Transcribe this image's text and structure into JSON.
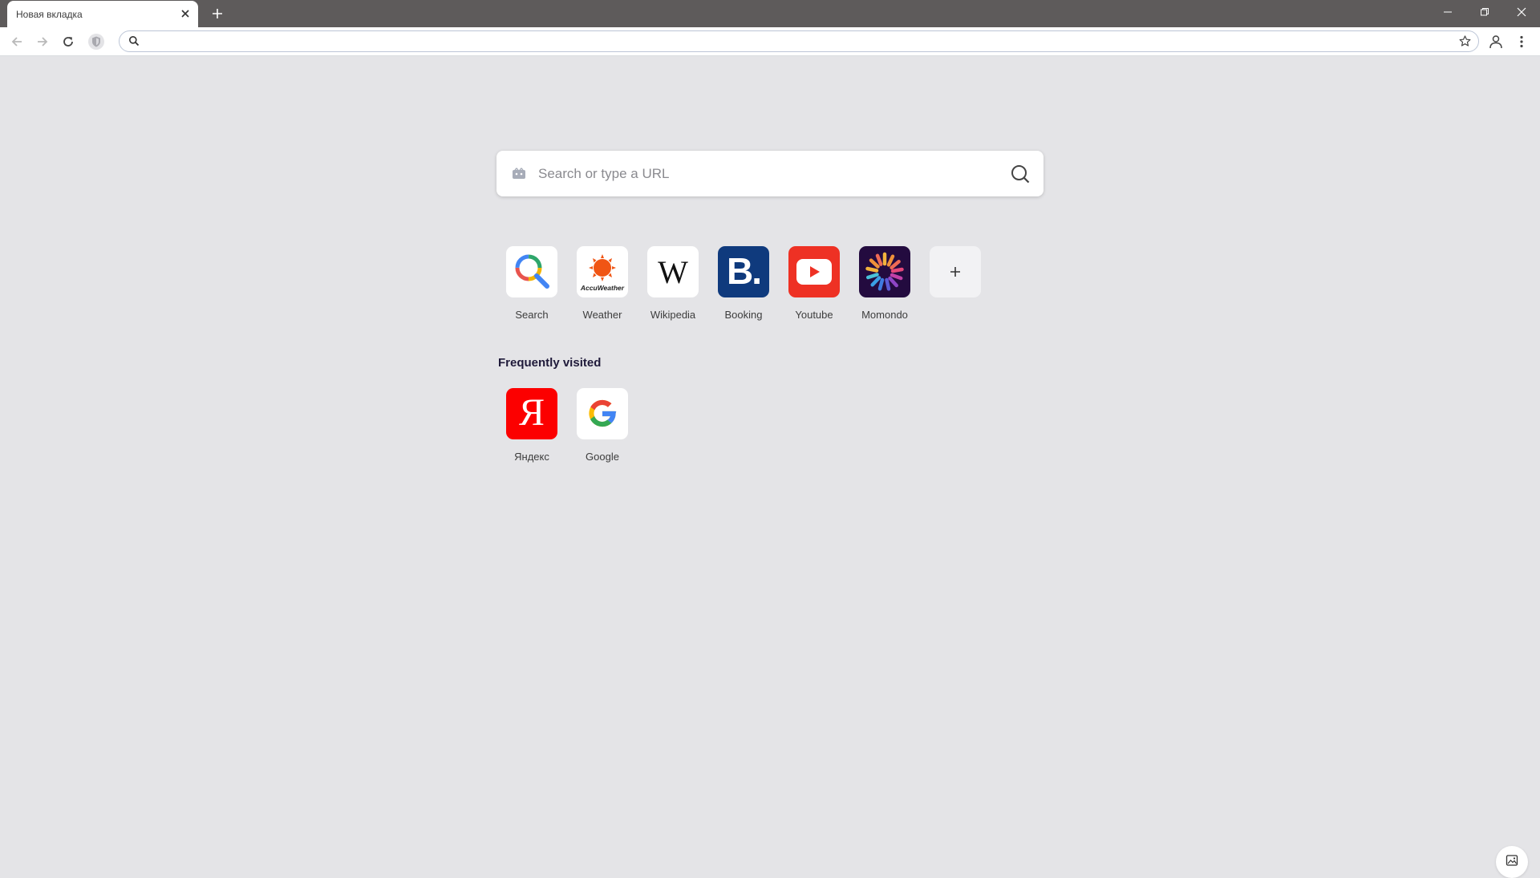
{
  "browser": {
    "tab_title": "Новая вкладка",
    "omnibox_value": "",
    "omnibox_placeholder": ""
  },
  "search": {
    "placeholder": "Search or type a URL"
  },
  "speed_dial": [
    {
      "label": "Search",
      "icon": "magnifier-logo-icon",
      "bg": "#ffffff"
    },
    {
      "label": "Weather",
      "icon": "accuweather-logo-icon",
      "bg": "#ffffff",
      "logo_text": "AccuWeather"
    },
    {
      "label": "Wikipedia",
      "icon": "wikipedia-logo-icon",
      "bg": "#ffffff",
      "logo_text": "W"
    },
    {
      "label": "Booking",
      "icon": "booking-logo-icon",
      "bg": "#0f3a7d",
      "logo_text": "B."
    },
    {
      "label": "Youtube",
      "icon": "youtube-logo-icon",
      "bg": "#ee3124"
    },
    {
      "label": "Momondo",
      "icon": "momondo-logo-icon",
      "bg": "#230b3f"
    },
    {
      "label": "",
      "icon": "plus-icon",
      "bg": "#f2f2f4"
    }
  ],
  "frequently_visited": {
    "title": "Frequently visited",
    "items": [
      {
        "label": "Яндекс",
        "icon": "yandex-logo-icon",
        "bg": "#fc0000",
        "logo_text": "Я"
      },
      {
        "label": "Google",
        "icon": "google-logo-icon",
        "bg": "#ffffff"
      }
    ]
  },
  "colors": {
    "titlebar": "#5e5b5b",
    "page_bg": "#e4e4e7",
    "accent": "#1f1a3a"
  }
}
